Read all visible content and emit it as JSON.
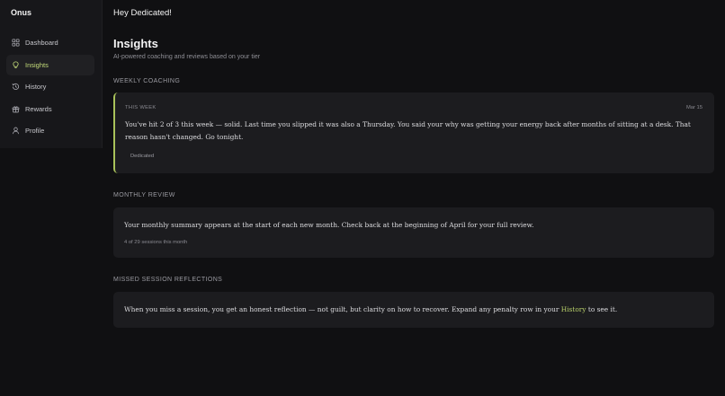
{
  "app": {
    "name": "Onus"
  },
  "sidebar": {
    "items": [
      {
        "label": "Dashboard",
        "icon": "dashboard-icon",
        "active": false
      },
      {
        "label": "Insights",
        "icon": "lightbulb-icon",
        "active": true
      },
      {
        "label": "History",
        "icon": "history-icon",
        "active": false
      },
      {
        "label": "Rewards",
        "icon": "gift-icon",
        "active": false
      },
      {
        "label": "Profile",
        "icon": "user-icon",
        "active": false
      }
    ]
  },
  "header": {
    "greeting": "Hey Dedicated!"
  },
  "page": {
    "title": "Insights",
    "subtitle": "AI-powered coaching and reviews based on your tier"
  },
  "weekly": {
    "section_label": "WEEKLY COACHING",
    "eyebrow": "THIS WEEK",
    "date": "Mar 15",
    "body": "You've hit 2 of 3 this week — solid. Last time you slipped it was also a Thursday. You said your why was getting your energy back after months of sitting at a desk. That reason hasn't changed. Go tonight.",
    "tier_tag": "Dedicated"
  },
  "monthly": {
    "section_label": "MONTHLY REVIEW",
    "body": "Your monthly summary appears at the start of each new month. Check back at the beginning of April for your full review.",
    "sessions": "4 of 29 sessions this month"
  },
  "missed": {
    "section_label": "MISSED SESSION REFLECTIONS",
    "body_before": "When you miss a session, you get an honest reflection — not guilt, but clarity on how to recover. Expand any penalty row in your",
    "link": "History",
    "body_after": "to see it."
  },
  "colors": {
    "background": "#101012",
    "sidebar": "#17171a",
    "card": "#1c1c1f",
    "accent": "#c4dc7a",
    "accent_border": "#a9c25a"
  }
}
